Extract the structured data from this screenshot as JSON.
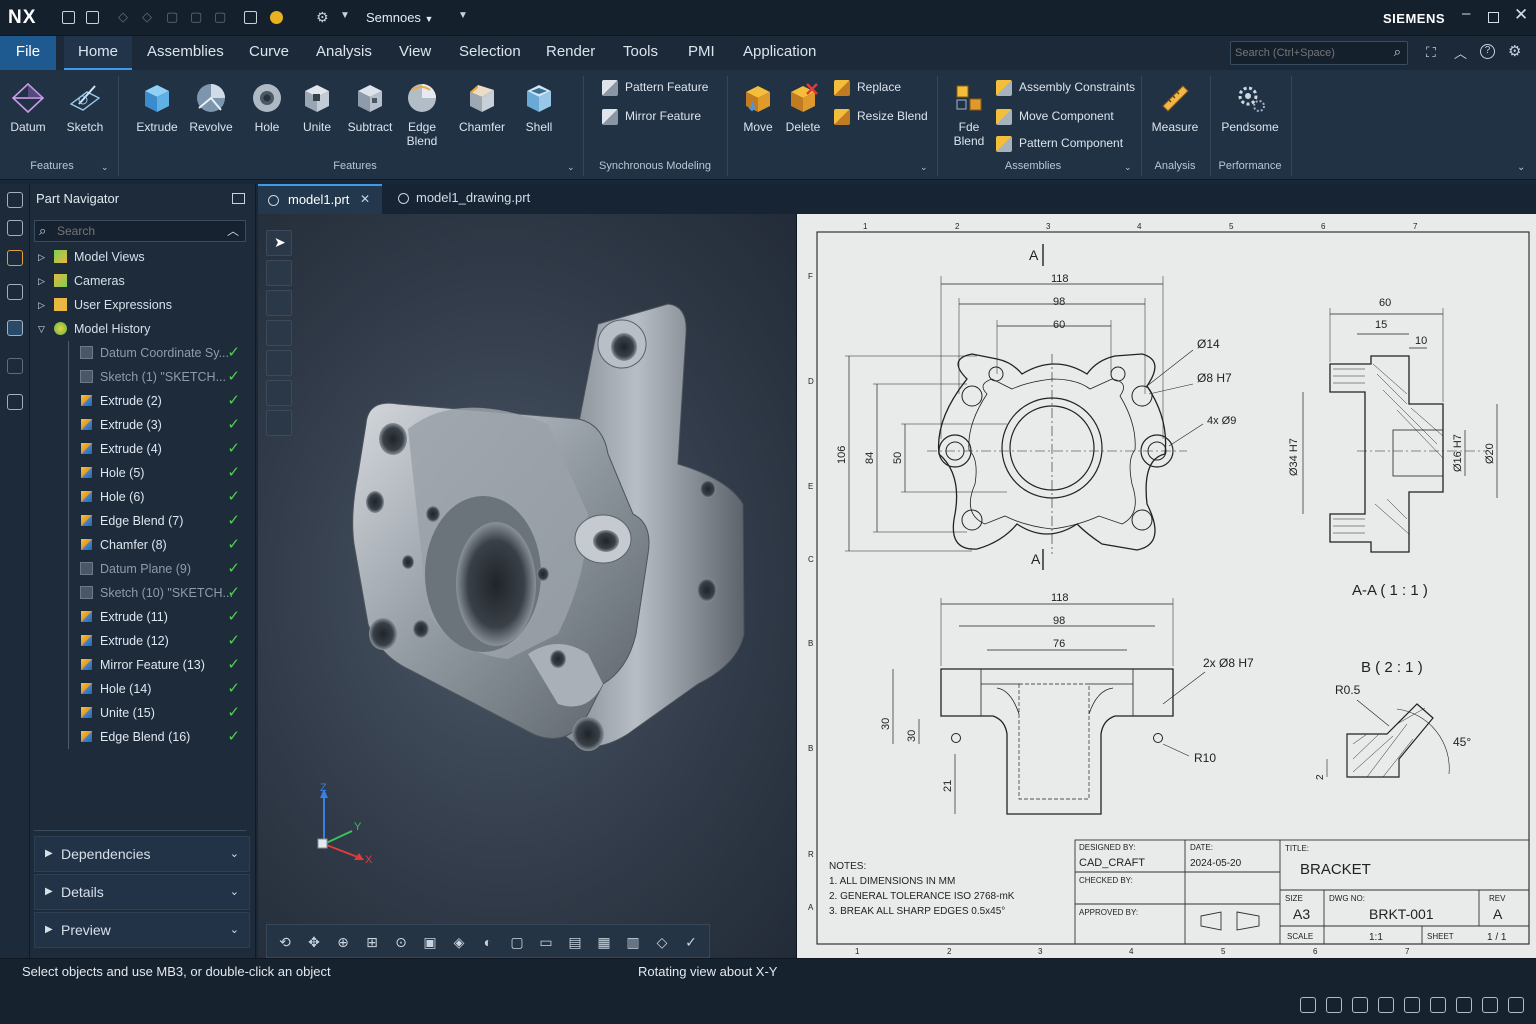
{
  "app": {
    "logo": "NX",
    "workspace": "Semnoes",
    "brand": "SIEMENS"
  },
  "menu": {
    "file": "File",
    "items": [
      "Home",
      "Assemblies",
      "Curve",
      "Analysis",
      "View",
      "Selection",
      "Render",
      "Tools",
      "PMI",
      "Application"
    ]
  },
  "search": {
    "placeholder": "Search (Ctrl+Space)"
  },
  "ribbon": {
    "datum": "Datum",
    "sketch": "Sketch",
    "features_group1": "Features",
    "extrude": "Extrude",
    "revolve": "Revolve",
    "hole": "Hole",
    "unite": "Unite",
    "subtract": "Subtract",
    "edge_blend_1": "Edge",
    "edge_blend_2": "Blend",
    "chamfer": "Chamfer",
    "shell": "Shell",
    "features_group2": "Features",
    "pattern_feature": "Pattern Feature",
    "mirror_feature": "Mirror Feature",
    "sync_group": "Synchronous Modeling",
    "move": "Move",
    "delete": "Delete",
    "replace": "Replace",
    "resize_blend": "Resize Blend",
    "fde_1": "Fde",
    "fde_2": "Blend",
    "assembly_constraints": "Assembly Constraints",
    "move_component": "Move Component",
    "pattern_component": "Pattern Component",
    "assemblies_group": "Assemblies",
    "measure": "Measure",
    "analysis_group": "Analysis",
    "perf_btn": "Pendsome",
    "performance_group": "Performance"
  },
  "navigator": {
    "title": "Part Navigator",
    "search_placeholder": "Search",
    "top_nodes": [
      "Model Views",
      "Cameras",
      "User Expressions",
      "Model History"
    ],
    "history": [
      {
        "label": "Datum Coordinate Sy...",
        "dim": true
      },
      {
        "label": "Sketch (1) \"SKETCH...",
        "dim": true
      },
      {
        "label": "Extrude (2)",
        "dim": false
      },
      {
        "label": "Extrude (3)",
        "dim": false
      },
      {
        "label": "Extrude (4)",
        "dim": false
      },
      {
        "label": "Hole (5)",
        "dim": false
      },
      {
        "label": "Hole (6)",
        "dim": false
      },
      {
        "label": "Edge Blend (7)",
        "dim": false
      },
      {
        "label": "Chamfer (8)",
        "dim": false
      },
      {
        "label": "Datum Plane (9)",
        "dim": true
      },
      {
        "label": "Sketch (10) \"SKETCH...",
        "dim": true
      },
      {
        "label": "Extrude (11)",
        "dim": false
      },
      {
        "label": "Extrude (12)",
        "dim": false
      },
      {
        "label": "Mirror Feature (13)",
        "dim": false
      },
      {
        "label": "Hole (14)",
        "dim": false
      },
      {
        "label": "Unite (15)",
        "dim": false
      },
      {
        "label": "Edge Blend (16)",
        "dim": false
      }
    ],
    "panels": [
      "Dependencies",
      "Details",
      "Preview"
    ]
  },
  "tabs": [
    "model1.prt",
    "model1_drawing.prt"
  ],
  "axes": {
    "x": "X",
    "y": "Y",
    "z": "Z"
  },
  "drawing": {
    "col_numbers": [
      "1",
      "2",
      "3",
      "4",
      "5",
      "6",
      "7"
    ],
    "bottom_numbers": [
      "1",
      "2",
      "3",
      "4",
      "5",
      "6",
      "7"
    ],
    "row_letters": [
      "F",
      "D",
      "E",
      "C",
      "B",
      "B",
      "R",
      "A"
    ],
    "section_marker": "A",
    "front": {
      "d118": "118",
      "d98": "98",
      "d60": "60",
      "d106": "106",
      "d84": "84",
      "d50": "50",
      "dia14": "Ø14",
      "dia8h7": "Ø8 H7",
      "holes": "4x Ø9"
    },
    "side": {
      "d60": "60",
      "d15": "15",
      "d10": "10",
      "dia34": "Ø34 H7",
      "dia16": "Ø16 H7",
      "dia20": "Ø20",
      "label": "A-A ( 1 : 1 )"
    },
    "bottom": {
      "d118": "118",
      "d98": "98",
      "d76": "76",
      "h30a": "30",
      "h30b": "30",
      "h21": "21",
      "dia8": "2x Ø8 H7",
      "r10": "R10"
    },
    "detail": {
      "label": "B ( 2 : 1 )",
      "r05": "R0.5",
      "angle": "45°",
      "h2": "2"
    },
    "notes": {
      "title": "NOTES:",
      "lines": [
        "1. ALL DIMENSIONS IN MM",
        "2. GENERAL TOLERANCE ISO 2768-mK",
        "3. BREAK ALL SHARP EDGES  0.5x45°"
      ]
    },
    "titleblock": {
      "designed_by_label": "DESIGNED BY:",
      "designed_by": "CAD_CRAFT",
      "date_label": "DATE:",
      "date": "2024-05-20",
      "checked_label": "CHECKED BY:",
      "approved_label": "APPROVED BY:",
      "title_label": "TITLE:",
      "title": "BRACKET",
      "size_label": "SIZE",
      "size": "A3",
      "dwg_label": "DWG NO:",
      "dwg": "BRKT-001",
      "rev_label": "REV",
      "rev": "A",
      "scale_label": "SCALE",
      "scale": "1:1",
      "sheet_label": "SHEET",
      "sheet": "1 / 1"
    }
  },
  "status": {
    "left": "Select objects and use MB3, or double-click an object",
    "center": "Rotating view about X-Y"
  }
}
